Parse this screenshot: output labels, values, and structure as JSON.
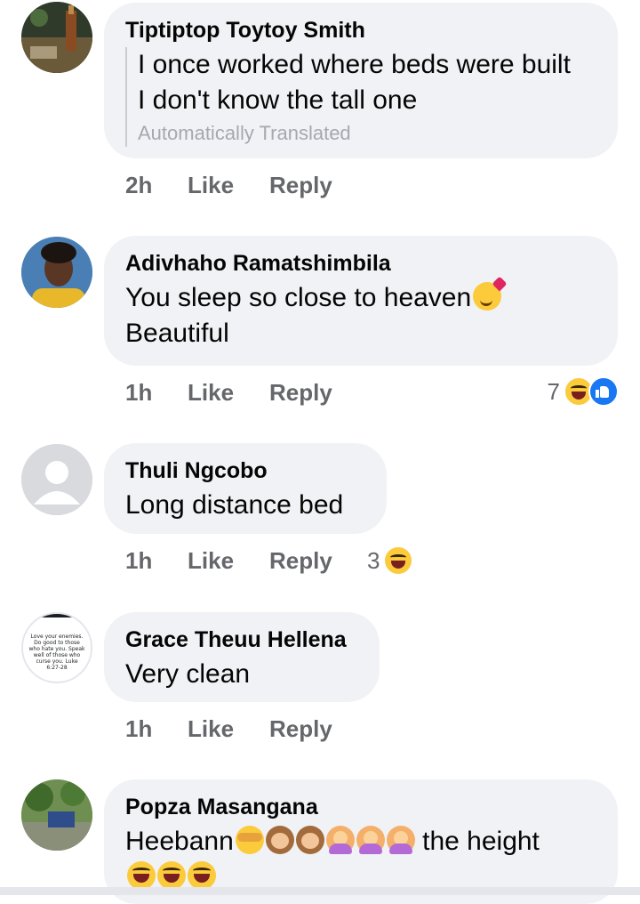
{
  "comments": [
    {
      "author": "Tiptiptop Toytoy Smith",
      "lines": [
        "I once worked where beds were built",
        "I don't know the tall one"
      ],
      "translation_note": "Automatically Translated",
      "time": "2h",
      "like": "Like",
      "reply": "Reply",
      "avatar_icon": "photo-avatar-icon"
    },
    {
      "author": "Adivhaho Ramatshimbila",
      "lines": [
        "You sleep so close to heaven",
        "Beautiful"
      ],
      "inline_emoji": "smiling-face-with-hearts-emoji",
      "time": "1h",
      "like": "Like",
      "reply": "Reply",
      "reaction_count": "7",
      "reaction_icons": [
        "haha-reaction-icon",
        "like-reaction-icon"
      ],
      "avatar_icon": "photo-avatar-icon"
    },
    {
      "author": "Thuli Ngcobo",
      "lines": [
        "Long distance bed"
      ],
      "time": "1h",
      "like": "Like",
      "reply": "Reply",
      "reaction_count": "3",
      "reaction_icons": [
        "haha-reaction-icon"
      ],
      "avatar_icon": "default-avatar-icon"
    },
    {
      "author": "Grace Theuu Hellena",
      "lines": [
        "Very clean"
      ],
      "time": "1h",
      "like": "Like",
      "reply": "Reply",
      "avatar_text": "Love your enemies. Do good to those who hate you. Speak well of those who curse you. Luke 6:27-28"
    },
    {
      "author": "Popza Masangana",
      "text_before": "Heebann",
      "text_after": " the height",
      "emoji_sequence": [
        "see-no-evil-monkey-emoji",
        "hear-no-evil-monkey-emoji",
        "speak-no-evil-monkey-emoji",
        "woman-gesturing-ok-emoji",
        "woman-gesturing-ok-emoji",
        "woman-gesturing-ok-emoji"
      ],
      "second_line_emojis": [
        "tears-of-joy-emoji",
        "tears-of-joy-emoji",
        "tears-of-joy-emoji"
      ],
      "avatar_icon": "photo-avatar-icon"
    }
  ],
  "colors": {
    "bubble": "#f0f2f5",
    "meta_text": "#65676b",
    "translated_text": "#a5a8ad",
    "like_blue": "#1877f2",
    "emoji_yellow": "#fbcb3c"
  }
}
